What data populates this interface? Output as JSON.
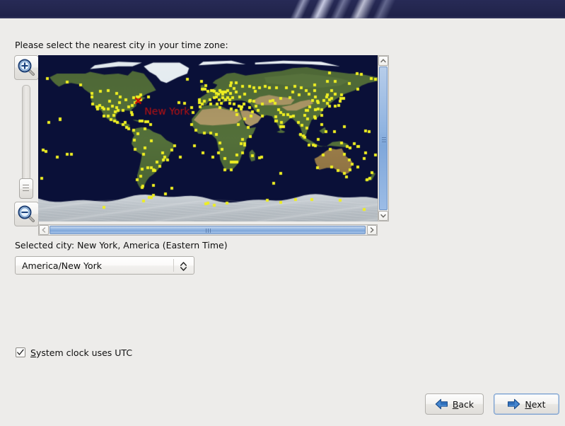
{
  "window": {
    "background_color": "#edecea",
    "banner_color": "#23264e"
  },
  "prompt": {
    "text": "Please select the nearest city in your time zone:"
  },
  "map": {
    "ocean_color": "#0a1038",
    "marker": {
      "icon": "x-marker-icon",
      "color": "#cc0000",
      "label": "New York",
      "label_color": "#bb1111"
    },
    "city_dot_color": "#eeee22",
    "zoom_in": {
      "icon": "zoom-in-magnifier-icon",
      "tooltip": "Zoom in"
    },
    "zoom_out": {
      "icon": "zoom-out-magnifier-icon",
      "tooltip": "Zoom out"
    },
    "zoom_slider": {
      "orientation": "vertical",
      "value": 0
    },
    "scrollbars": {
      "vertical": {
        "up_icon": "chevron-up-icon",
        "down_icon": "chevron-down-icon"
      },
      "horizontal": {
        "left_icon": "chevron-left-icon",
        "right_icon": "chevron-right-icon"
      }
    }
  },
  "selection": {
    "label": "Selected city: New York, America (Eastern Time)",
    "timezone_value": "America/New York",
    "combo_icon": "up-down-chevron-icon"
  },
  "options": {
    "utc_clock": {
      "checked": true,
      "label_prefix": "",
      "label_mnemonic": "S",
      "label_rest": "ystem clock uses UTC",
      "check_icon": "checkmark-icon"
    }
  },
  "footer": {
    "back": {
      "mnemonic": "B",
      "label_rest": "ack",
      "icon": "arrow-left-icon"
    },
    "next": {
      "mnemonic": "N",
      "label_rest": "ext",
      "icon": "arrow-right-icon",
      "is_default": true
    },
    "arrow_color": "#2b6cb8"
  }
}
